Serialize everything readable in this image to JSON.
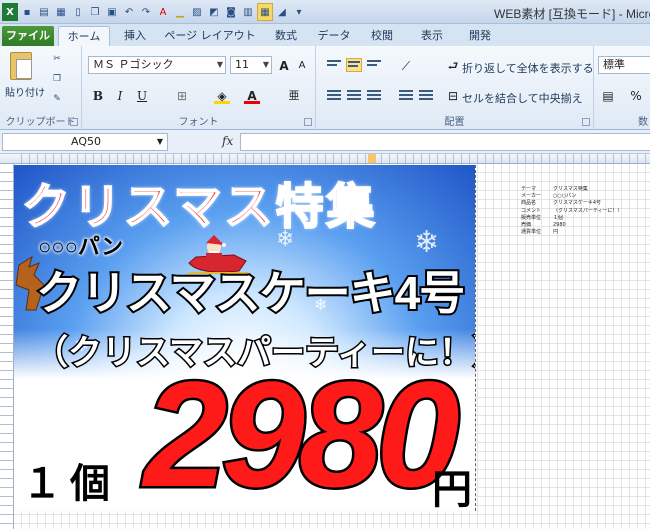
{
  "window": {
    "title": "WEB素材 [互換モード] - Micro"
  },
  "tabs": [
    "ファイル",
    "ホーム",
    "挿入",
    "ページ レイアウト",
    "数式",
    "データ",
    "校閲",
    "表示",
    "開発"
  ],
  "ribbon": {
    "clipboard": {
      "paste_label": "貼り付け",
      "group_label": "クリップボード"
    },
    "font": {
      "font_name": "ＭＳ Ｐゴシック",
      "font_size": "11",
      "group_label": "フォント",
      "bold": "B",
      "italic": "I",
      "underline": "U",
      "grow": "A",
      "shrink": "A"
    },
    "alignment": {
      "wrap_text": "折り返して全体を表示する",
      "merge_center": "セルを結合して中央揃え",
      "group_label": "配置"
    },
    "number": {
      "format": "標準",
      "percent": "%",
      "group_label": "数"
    }
  },
  "formula_bar": {
    "name_box": "AQ50",
    "fx": "fx"
  },
  "poster": {
    "title": "クリスマス特集",
    "brand": "○○○パン",
    "product": "クリスマスケーキ4号",
    "subtitle": "（クリスマスパーティーに！）",
    "quantity": "１個",
    "price": "2980",
    "yen": "円"
  },
  "side_table": [
    {
      "key": "テーマ",
      "value": "クリスマス特集"
    },
    {
      "key": "メーカー",
      "value": "○○○パン"
    },
    {
      "key": "商品名",
      "value": "クリスマスケーキ4号"
    },
    {
      "key": "コメント",
      "value": "（クリスマスパーティーに！）"
    },
    {
      "key": "販売単位",
      "value": "１個"
    },
    {
      "key": "売価",
      "value": "2980"
    },
    {
      "key": "通貨単位",
      "value": "円"
    }
  ],
  "colors": {
    "accent": "#2e7a26",
    "price_red": "#ff1a1a",
    "ribbon_blue": "#dfe9f5"
  }
}
